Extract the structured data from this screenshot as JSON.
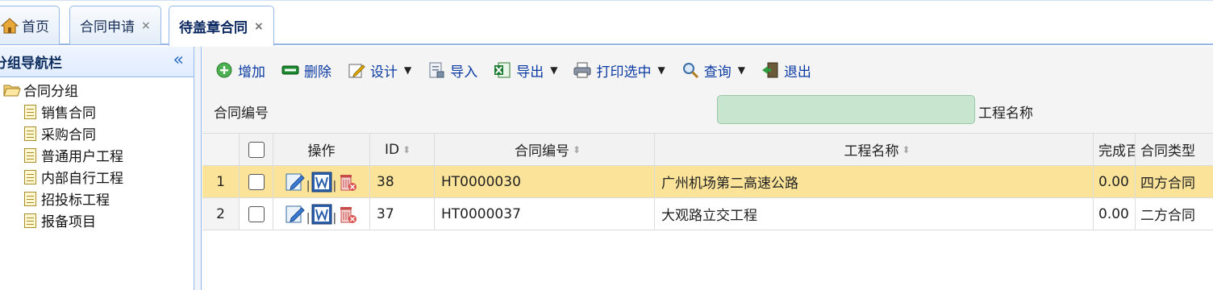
{
  "tabs": [
    {
      "label": "首页",
      "closable": false
    },
    {
      "label": "合同申请",
      "closable": true
    },
    {
      "label": "待盖章合同",
      "closable": true,
      "active": true
    }
  ],
  "tab_close_glyph": "×",
  "sidebar": {
    "title": "分组导航栏",
    "collapse_glyph": "«",
    "root": "合同分组",
    "items": [
      "销售合同",
      "采购合同",
      "普通用户工程",
      "内部自行工程",
      "招投标工程",
      "报备项目"
    ]
  },
  "toolbar": {
    "buttons": [
      {
        "label": "增加",
        "icon": "add-icon",
        "has_menu": false
      },
      {
        "label": "删除",
        "icon": "delete-icon",
        "has_menu": false
      },
      {
        "label": "设计",
        "icon": "design-icon",
        "has_menu": true
      },
      {
        "label": "导入",
        "icon": "import-icon",
        "has_menu": false
      },
      {
        "label": "导出",
        "icon": "export-icon",
        "has_menu": true
      },
      {
        "label": "打印选中",
        "icon": "printer-icon",
        "has_menu": true
      },
      {
        "label": "查询",
        "icon": "search-icon",
        "has_menu": true
      },
      {
        "label": "退出",
        "icon": "exit-icon",
        "has_menu": false
      }
    ]
  },
  "search": {
    "contract_no_label": "合同编号",
    "project_name_label": "工程名称",
    "input_value": ""
  },
  "grid": {
    "headers": {
      "ops": "操作",
      "id": "ID",
      "code": "合同编号",
      "name": "工程名称",
      "done": "完成百",
      "type": "合同类型"
    },
    "rows": [
      {
        "num": "1",
        "id": "38",
        "code": "HT0000030",
        "name": "广州机场第二高速公路",
        "done": "0.00",
        "type": "四方合同",
        "selected": true
      },
      {
        "num": "2",
        "id": "37",
        "code": "HT0000037",
        "name": "大观路立交工程",
        "done": "0.00",
        "type": "二方合同",
        "selected": false
      }
    ]
  },
  "colors": {
    "accent_blue": "#95b8e7",
    "selected_row": "#fbe49a",
    "search_input_bg": "#c8e6cf",
    "link_text": "#0a3aa3"
  }
}
